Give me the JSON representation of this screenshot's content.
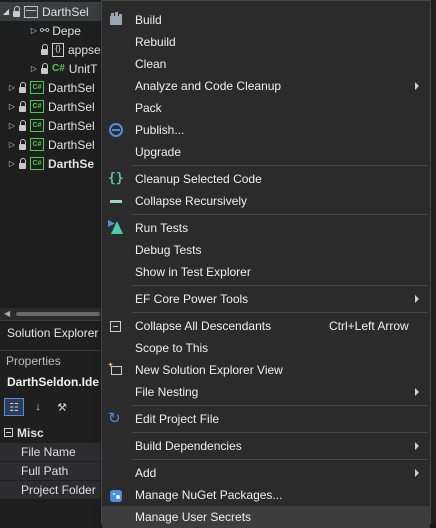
{
  "tree": {
    "rows": [
      {
        "label": "DarthSel",
        "icon": "solution-icon",
        "bold": false
      },
      {
        "label": "Depe",
        "icon": "dependencies-icon",
        "bold": false
      },
      {
        "label": "appse",
        "icon": "json-file-icon",
        "bold": false
      },
      {
        "label": "UnitT",
        "icon": "csharp-file-icon",
        "bold": false
      },
      {
        "label": "DarthSel",
        "icon": "csharp-project-icon",
        "bold": false
      },
      {
        "label": "DarthSel",
        "icon": "csharp-project-icon",
        "bold": false
      },
      {
        "label": "DarthSel",
        "icon": "csharp-project-icon",
        "bold": false
      },
      {
        "label": "DarthSel",
        "icon": "csharp-project-icon",
        "bold": false
      },
      {
        "label": "DarthSe",
        "icon": "csharp-project-icon",
        "bold": true
      }
    ],
    "csharp_glyph": "C#",
    "json_glyph": "{}",
    "tab_label": "Solution Explorer"
  },
  "properties": {
    "title": "Properties",
    "object_name": "DarthSeldon.Ide",
    "section": "Misc",
    "rows": [
      "File Name",
      "Full Path",
      "Project Folder"
    ]
  },
  "menu": {
    "items": [
      {
        "label": "Build",
        "icon": "build-icon"
      },
      {
        "label": "Rebuild"
      },
      {
        "label": "Clean"
      },
      {
        "label": "Analyze and Code Cleanup",
        "submenu": true
      },
      {
        "label": "Pack"
      },
      {
        "label": "Publish...",
        "icon": "globe-icon"
      },
      {
        "label": "Upgrade"
      },
      {
        "label": "Cleanup Selected Code",
        "icon": "braces-icon"
      },
      {
        "label": "Collapse Recursively",
        "icon": "collapse-recursive-icon"
      },
      {
        "label": "Run Tests",
        "icon": "run-tests-icon"
      },
      {
        "label": "Debug Tests"
      },
      {
        "label": "Show in Test Explorer"
      },
      {
        "label": "EF Core Power Tools",
        "submenu": true
      },
      {
        "label": "Collapse All Descendants",
        "shortcut": "Ctrl+Left Arrow",
        "icon": "collapse-icon"
      },
      {
        "label": "Scope to This"
      },
      {
        "label": "New Solution Explorer View",
        "icon": "new-window-icon"
      },
      {
        "label": "File Nesting",
        "submenu": true
      },
      {
        "label": "Edit Project File",
        "icon": "edit-project-icon"
      },
      {
        "label": "Build Dependencies",
        "submenu": true
      },
      {
        "label": "Add",
        "submenu": true
      },
      {
        "label": "Manage NuGet Packages...",
        "icon": "nuget-icon"
      },
      {
        "label": "Manage User Secrets",
        "highlighted": true
      }
    ],
    "braces_glyph": "{}",
    "edit_glyph": "↻"
  },
  "colors": {
    "background": "#1f1f1f",
    "menu_bg": "#2b2b2b",
    "accent_blue": "#4b8fe2",
    "accent_teal": "#4ec9b0",
    "csharp_green": "#4ec94e"
  }
}
